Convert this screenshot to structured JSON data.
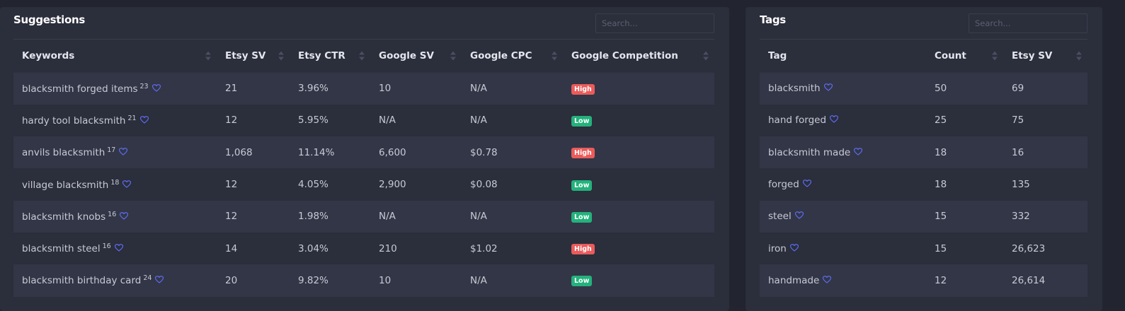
{
  "suggestions": {
    "title": "Suggestions",
    "search_placeholder": "Search...",
    "columns": [
      "Keywords",
      "Etsy SV",
      "Etsy CTR",
      "Google SV",
      "Google CPC",
      "Google Competition"
    ],
    "rows": [
      {
        "keyword": "blacksmith forged items",
        "count": "23",
        "etsy_sv": "21",
        "etsy_ctr": "3.96%",
        "google_sv": "10",
        "google_cpc": "N/A",
        "competition": "High"
      },
      {
        "keyword": "hardy tool blacksmith",
        "count": "21",
        "etsy_sv": "12",
        "etsy_ctr": "5.95%",
        "google_sv": "N/A",
        "google_cpc": "N/A",
        "competition": "Low"
      },
      {
        "keyword": "anvils blacksmith",
        "count": "17",
        "etsy_sv": "1,068",
        "etsy_ctr": "11.14%",
        "google_sv": "6,600",
        "google_cpc": "$0.78",
        "competition": "High"
      },
      {
        "keyword": "village blacksmith",
        "count": "18",
        "etsy_sv": "12",
        "etsy_ctr": "4.05%",
        "google_sv": "2,900",
        "google_cpc": "$0.08",
        "competition": "Low"
      },
      {
        "keyword": "blacksmith knobs",
        "count": "16",
        "etsy_sv": "12",
        "etsy_ctr": "1.98%",
        "google_sv": "N/A",
        "google_cpc": "N/A",
        "competition": "Low"
      },
      {
        "keyword": "blacksmith steel",
        "count": "16",
        "etsy_sv": "14",
        "etsy_ctr": "3.04%",
        "google_sv": "210",
        "google_cpc": "$1.02",
        "competition": "High"
      },
      {
        "keyword": "blacksmith birthday card",
        "count": "24",
        "etsy_sv": "20",
        "etsy_ctr": "9.82%",
        "google_sv": "10",
        "google_cpc": "N/A",
        "competition": "Low"
      }
    ]
  },
  "tags": {
    "title": "Tags",
    "search_placeholder": "Search...",
    "columns": [
      "Tag",
      "Count",
      "Etsy SV"
    ],
    "rows": [
      {
        "tag": "blacksmith",
        "count": "50",
        "etsy_sv": "69"
      },
      {
        "tag": "hand forged",
        "count": "25",
        "etsy_sv": "75"
      },
      {
        "tag": "blacksmith made",
        "count": "18",
        "etsy_sv": "16"
      },
      {
        "tag": "forged",
        "count": "18",
        "etsy_sv": "135"
      },
      {
        "tag": "steel",
        "count": "15",
        "etsy_sv": "332"
      },
      {
        "tag": "iron",
        "count": "15",
        "etsy_sv": "26,623"
      },
      {
        "tag": "handmade",
        "count": "12",
        "etsy_sv": "26,614"
      }
    ]
  },
  "icons": {
    "favorite": "heart-outline-icon",
    "sort": "sort-arrows-icon"
  },
  "colors": {
    "accent": "#5b6cf0",
    "high": "#ea5b5b",
    "low": "#23b27c"
  }
}
